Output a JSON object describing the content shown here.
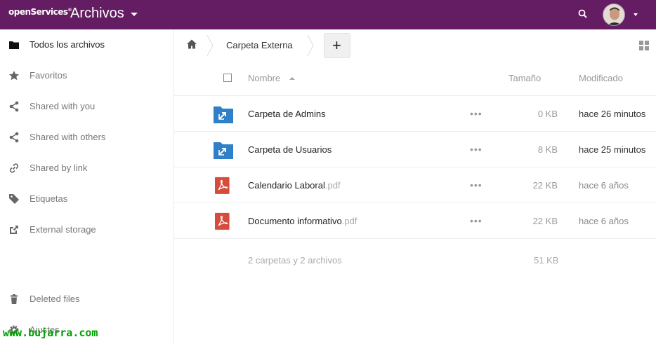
{
  "header": {
    "brand": "openServices",
    "brand_mark": "®",
    "app_title": "Archivos",
    "icons": {
      "search": "search-icon",
      "avatar": "avatar",
      "menu": "chevron-down-icon"
    },
    "color": "#641c62"
  },
  "sidebar": {
    "items": [
      {
        "label": "Todos los archivos",
        "icon": "folder-icon",
        "active": true
      },
      {
        "label": "Favoritos",
        "icon": "star-icon"
      },
      {
        "label": "Shared with you",
        "icon": "share-icon"
      },
      {
        "label": "Shared with others",
        "icon": "share-icon"
      },
      {
        "label": "Shared by link",
        "icon": "link-icon"
      },
      {
        "label": "Etiquetas",
        "icon": "tag-icon"
      },
      {
        "label": "External storage",
        "icon": "external-link-icon"
      }
    ],
    "bottom_items": [
      {
        "label": "Deleted files",
        "icon": "trash-icon"
      },
      {
        "label": "Ajustes",
        "icon": "gear-icon"
      }
    ]
  },
  "breadcrumb": {
    "home_icon": "home-icon",
    "current": "Carpeta Externa",
    "new_label": "+"
  },
  "table": {
    "columns": {
      "name": "Nombre",
      "size": "Tamaño",
      "modified": "Modificado"
    },
    "rows": [
      {
        "name": "Carpeta de Admins",
        "ext": "",
        "type": "shared-folder-icon",
        "size": "0 KB",
        "modified": "hace 26 minutos"
      },
      {
        "name": "Carpeta de Usuarios",
        "ext": "",
        "type": "shared-folder-icon",
        "size": "8 KB",
        "modified": "hace 25 minutos"
      },
      {
        "name": "Calendario Laboral",
        "ext": ".pdf",
        "type": "pdf-icon",
        "size": "22 KB",
        "modified": "hace 6 años"
      },
      {
        "name": "Documento informativo",
        "ext": ".pdf",
        "type": "pdf-icon",
        "size": "22 KB",
        "modified": "hace 6 años"
      }
    ],
    "row_menu": "•••",
    "summary": "2 carpetas y 2 archivos",
    "summary_size": "51 KB"
  },
  "watermark": "www.bujarra.com",
  "colors": {
    "folder": "#2f80c9",
    "pdf": "#d64b3c",
    "watermark": "#00a000"
  }
}
